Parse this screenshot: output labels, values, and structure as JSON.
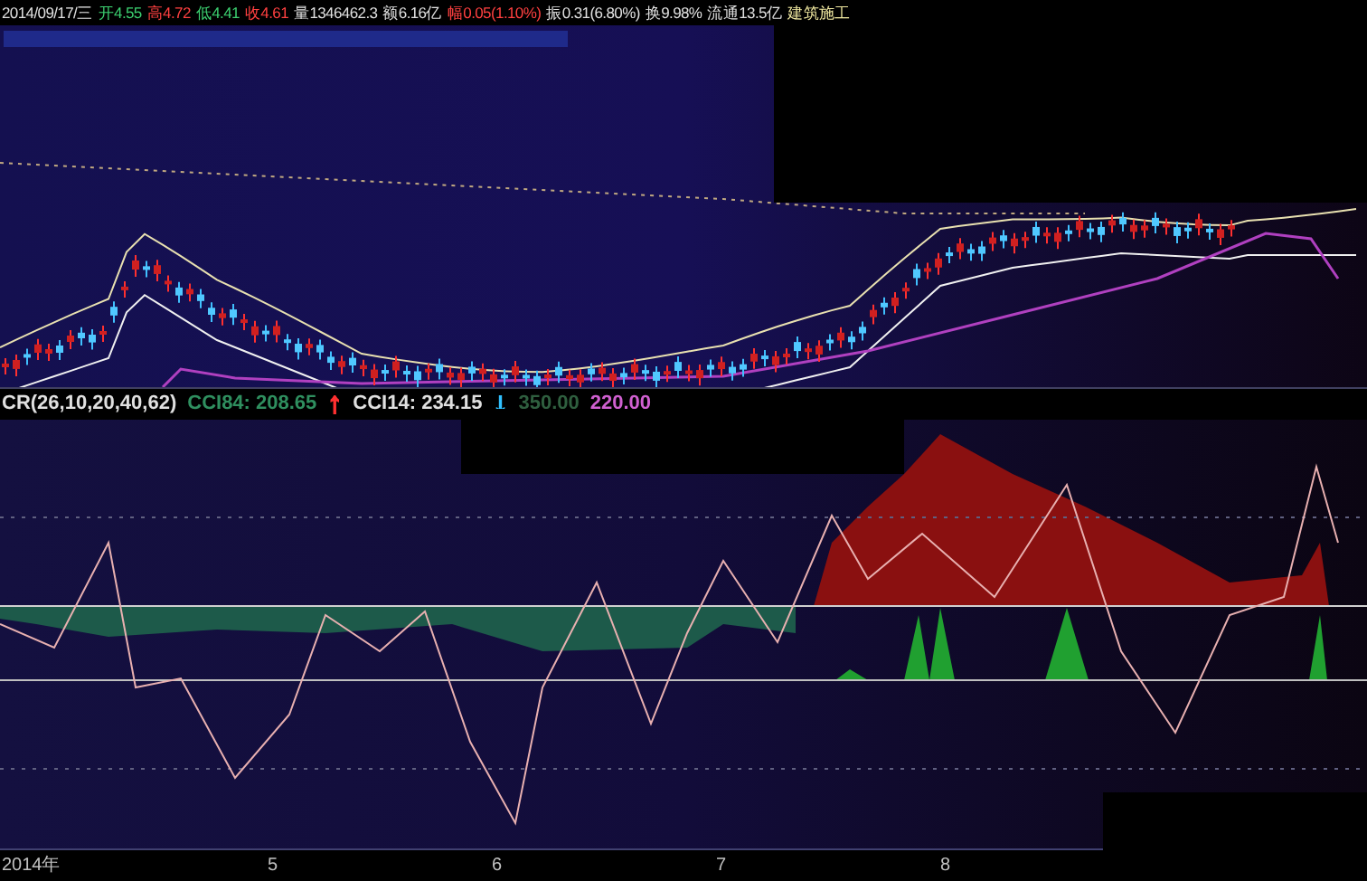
{
  "quote_bar": [
    {
      "text": "2014/09/17/三",
      "color": "#e0e0e0"
    },
    {
      "text": "开4.55",
      "color": "#3cd070"
    },
    {
      "text": "高4.72",
      "color": "#ff4040"
    },
    {
      "text": "低4.41",
      "color": "#3cd070"
    },
    {
      "text": "收4.61",
      "color": "#ff4040"
    },
    {
      "text": "量1346462.3",
      "color": "#e0e0e0"
    },
    {
      "text": "额6.16亿",
      "color": "#e0e0e0"
    },
    {
      "text": "幅0.05(1.10%)",
      "color": "#ff4040"
    },
    {
      "text": "振0.31(6.80%)",
      "color": "#e0e0e0"
    },
    {
      "text": "换9.98%",
      "color": "#e0e0e0"
    },
    {
      "text": "流通13.5亿",
      "color": "#e0e0e0"
    },
    {
      "text": "建筑施工",
      "color": "#f0e8a0"
    }
  ],
  "indicator_legend": [
    {
      "text": "CR(26,10,20,40,62)",
      "color": "#e0e0e0"
    },
    {
      "text": "CCI84: 208.65",
      "color": "#2f8f5f"
    },
    {
      "text": "↑",
      "color": "#ff3030",
      "kind": "arrow"
    },
    {
      "text": "CCI14: 234.15",
      "color": "#e0e0e0"
    },
    {
      "text": "↓",
      "color": "#30c0ff",
      "kind": "arrow"
    },
    {
      "text": "350.00",
      "color": "#2f5f3f"
    },
    {
      "text": "220.00",
      "color": "#d060d0"
    }
  ],
  "time_axis": [
    "2014年",
    "5",
    "6",
    "7",
    "8"
  ]
}
